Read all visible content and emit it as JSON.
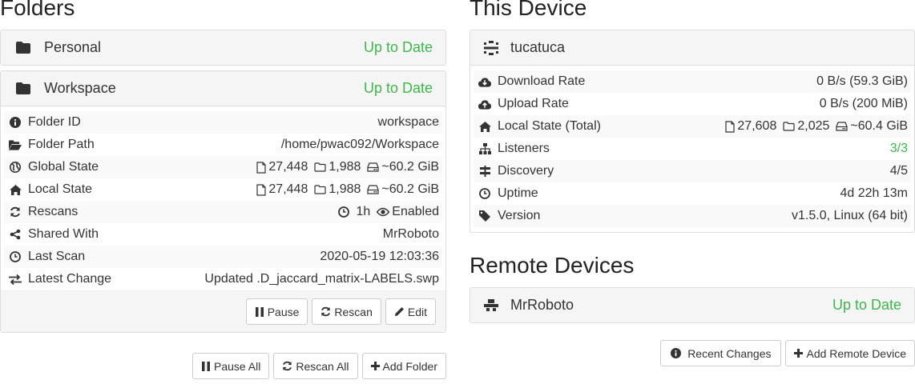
{
  "folders": {
    "title": "Folders",
    "items": [
      {
        "name": "Personal",
        "status": "Up to Date"
      },
      {
        "name": "Workspace",
        "status": "Up to Date"
      }
    ],
    "details": {
      "folder_id": {
        "label": "Folder ID",
        "value": "workspace"
      },
      "folder_path": {
        "label": "Folder Path",
        "value": "/home/pwac092/Workspace"
      },
      "global_state": {
        "label": "Global State",
        "files": "27,448",
        "dirs": "1,988",
        "size": "~60.2 GiB"
      },
      "local_state": {
        "label": "Local State",
        "files": "27,448",
        "dirs": "1,988",
        "size": "~60.2 GiB"
      },
      "rescans": {
        "label": "Rescans",
        "interval": "1h",
        "watch": "Enabled"
      },
      "shared_with": {
        "label": "Shared With",
        "value": "MrRoboto"
      },
      "last_scan": {
        "label": "Last Scan",
        "value": "2020-05-19 12:03:36"
      },
      "latest_change": {
        "label": "Latest Change",
        "value": "Updated .D_jaccard_matrix-LABELS.swp"
      }
    },
    "buttons": {
      "pause": "Pause",
      "rescan": "Rescan",
      "edit": "Edit"
    },
    "footer_buttons": {
      "pause_all": "Pause All",
      "rescan_all": "Rescan All",
      "add_folder": "Add Folder"
    }
  },
  "device": {
    "title": "This Device",
    "name": "tucatuca",
    "rows": {
      "download": {
        "label": "Download Rate",
        "value": "0 B/s (59.3 GiB)"
      },
      "upload": {
        "label": "Upload Rate",
        "value": "0 B/s (200 MiB)"
      },
      "local_state": {
        "label": "Local State (Total)",
        "files": "27,608",
        "dirs": "2,025",
        "size": "~60.4 GiB"
      },
      "listeners": {
        "label": "Listeners",
        "value": "3/3"
      },
      "discovery": {
        "label": "Discovery",
        "value": "4/5"
      },
      "uptime": {
        "label": "Uptime",
        "value": "4d 22h 13m"
      },
      "version": {
        "label": "Version",
        "value": "v1.5.0, Linux (64 bit)"
      }
    }
  },
  "remote": {
    "title": "Remote Devices",
    "items": [
      {
        "name": "MrRoboto",
        "status": "Up to Date"
      }
    ],
    "buttons": {
      "recent_changes": "Recent Changes",
      "add_remote": "Add Remote Device"
    }
  },
  "colors": {
    "status_green": "#3cb84a",
    "panel_head_bg": "#f5f5f5",
    "border": "#dddddd"
  }
}
